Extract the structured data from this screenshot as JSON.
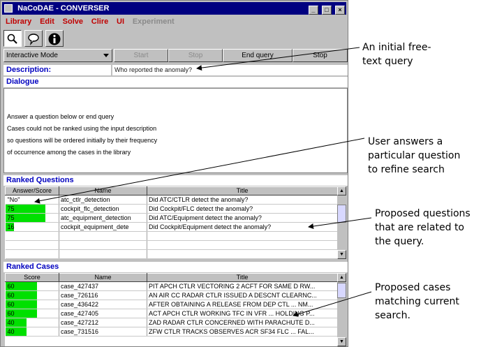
{
  "window": {
    "title": "NaCoDAE - CONVERSER"
  },
  "menu": [
    "Library",
    "Edit",
    "Solve",
    "Clire",
    "UI",
    "Experiment"
  ],
  "menu_disabled": "Experiment",
  "toolbar_icons": [
    "search-icon",
    "dialog-bubble-icon",
    "info-icon"
  ],
  "controls": {
    "mode": "Interactive Mode",
    "start": "Start",
    "stop_disabled": "Stop",
    "end_query": "End query",
    "stop": "Stop"
  },
  "description": {
    "label": "Description:",
    "value": "Who reported the anomaly?"
  },
  "dialogue": {
    "heading": "Dialogue",
    "lines": [
      "Answer a question below or end query",
      "Cases could not be ranked using the input description",
      "so questions will be ordered initially by their frequency",
      "of occurrence among the cases in the library"
    ]
  },
  "questions": {
    "heading": "Ranked Questions",
    "columns": [
      "Answer/Score",
      "Name",
      "Title"
    ],
    "rows": [
      {
        "score": "\"No\"",
        "fill": 0,
        "name": "atc_ctlr_detection",
        "title": "Did ATC/CTLR detect the anomaly?"
      },
      {
        "score": "75",
        "fill": 0.75,
        "name": "cockpit_flc_detection",
        "title": "Did Cockpit/FLC detect the anomaly?"
      },
      {
        "score": "75",
        "fill": 0.75,
        "name": "atc_equipment_detection",
        "title": "Did ATC/Equipment detect the anomaly?"
      },
      {
        "score": "16",
        "fill": 0.16,
        "name": "cockpit_equipment_dete",
        "title": "Did Cockpit/Equipment detect the anomaly?"
      }
    ]
  },
  "cases": {
    "heading": "Ranked Cases",
    "columns": [
      "Score",
      "Name",
      "Title"
    ],
    "rows": [
      {
        "score": "60",
        "fill": 0.6,
        "name": "case_427437",
        "title": "PIT APCH CTLR VECTORING 2 ACFT FOR SAME D RW..."
      },
      {
        "score": "60",
        "fill": 0.6,
        "name": "case_726116",
        "title": "AN AIR CC RADAR CTLR ISSUED A DESCNT CLEARNC..."
      },
      {
        "score": "60",
        "fill": 0.6,
        "name": "case_436422",
        "title": "AFTER OBTAINING A RELEASE FROM DEP CTL ... NM..."
      },
      {
        "score": "60",
        "fill": 0.6,
        "name": "case_427405",
        "title": "ACT APCH CTLR WORKING TFC IN VFR ... HOLDING P..."
      },
      {
        "score": "40",
        "fill": 0.4,
        "name": "case_427212",
        "title": "ZAD RADAR CTLR CONCERNED WITH PARACHUTE D..."
      },
      {
        "score": "40",
        "fill": 0.4,
        "name": "case_731516",
        "title": "ZFW CTLR TRACKS OBSERVES ACR SF34 FLC ... FAL..."
      }
    ]
  },
  "annotations": [
    "An initial free-",
    "text query",
    "User answers a",
    "particular question",
    "to refine search",
    "Proposed questions",
    "that are related to",
    "the query.",
    "Proposed cases",
    "matching current",
    "search."
  ],
  "colors": {
    "title_bar": "#000080",
    "menu_text": "#c00000",
    "heading_text": "#0000c0",
    "score_bar": "#00e000"
  }
}
